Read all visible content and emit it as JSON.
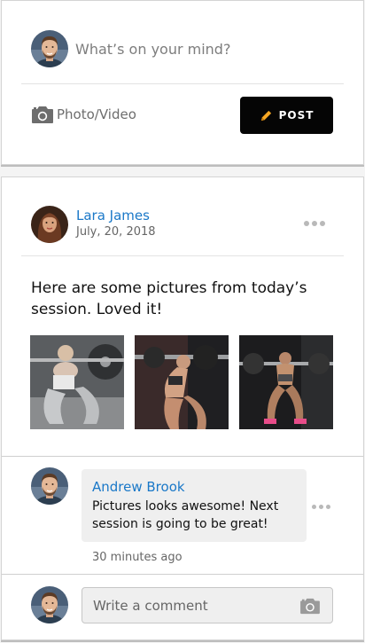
{
  "composer": {
    "placeholder": "What’s on your mind?",
    "photo_video_label": "Photo/Video",
    "photo_icon": "camera-icon",
    "post_label": "POST",
    "post_icon": "pencil-icon"
  },
  "post": {
    "author": "Lara James",
    "date": "July, 20, 2018",
    "text": "Here are some pictures from today’s session. Loved it!",
    "more_icon": "more-dots-icon"
  },
  "comment": {
    "author": "Andrew Brook",
    "text": "Pictures looks awesome! Next session is going to be great!",
    "time": "30 minutes ago"
  },
  "comment_input": {
    "placeholder": "Write a comment",
    "icon": "camera-icon"
  },
  "colors": {
    "link": "#1a78c8",
    "post_button_bg": "#050505",
    "post_button_icon": "#f5a623",
    "comment_bubble": "#efefef"
  }
}
